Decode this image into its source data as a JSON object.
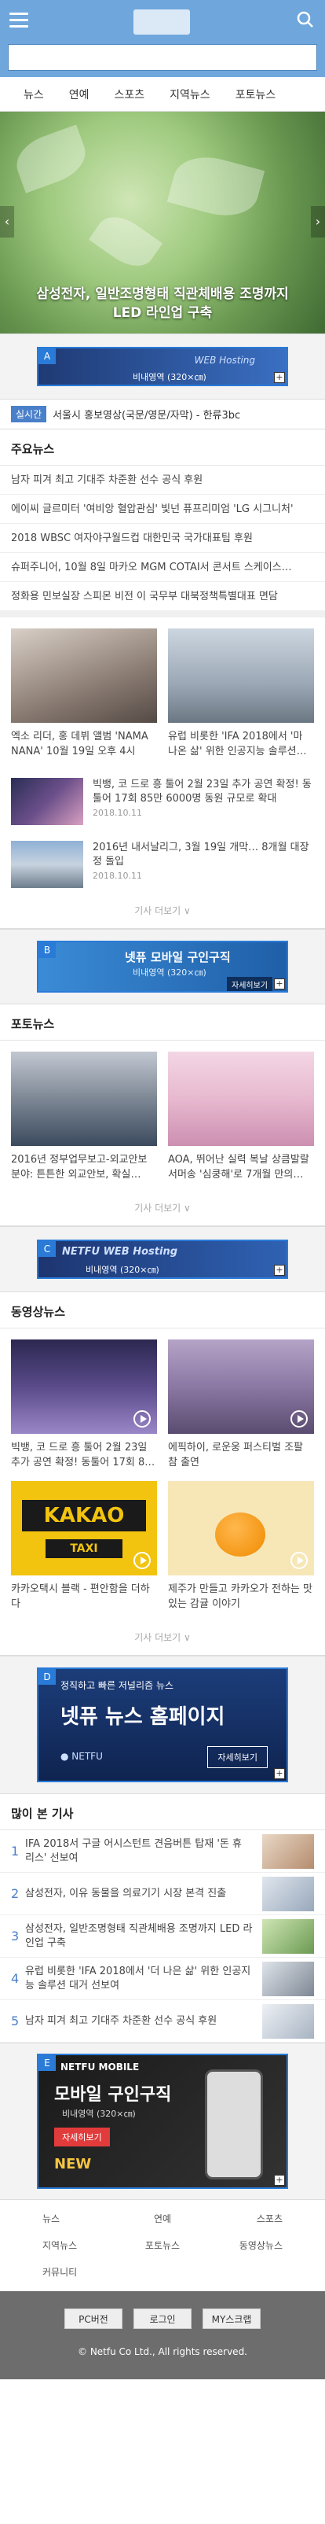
{
  "nav": [
    "뉴스",
    "연예",
    "스포츠",
    "지역뉴스",
    "포토뉴스"
  ],
  "hero": {
    "caption": "삼성전자, 일반조명형태 직관체배용 조명까지 LED 라인업 구축",
    "prev": "‹",
    "next": "›"
  },
  "ads": {
    "A": {
      "badge": "A",
      "title": "WEB Hosting",
      "sub": "비내영역 (320×㎝)"
    },
    "B": {
      "badge": "B",
      "title": "넷퓨 모바일 구인구직",
      "sub": "비내영역 (320×㎝)",
      "btn": "자세히보기"
    },
    "C": {
      "badge": "C",
      "title": "NETFU WEB Hosting",
      "sub": "비내영역 (320×㎝)"
    },
    "D": {
      "badge": "D",
      "tag": "정직하고 빠른 저널리즘 뉴스",
      "title": "넷퓨 뉴스 홈페이지",
      "btn": "자세히보기",
      "brand": "● NETFU"
    },
    "E": {
      "badge": "E",
      "brand": "NETFU MOBILE",
      "title": "모바일 구인구직",
      "sub": "비내영역 (320×㎝)",
      "btn": "자세히보기",
      "new": "NEW"
    },
    "plus": "+"
  },
  "breaking": {
    "tag": "실시간",
    "text": "서울시 홍보영상(국문/영문/자막) - 한류3bc"
  },
  "main_news": {
    "title": "주요뉴스",
    "items": [
      "남자 피겨 최고 기대주 차준환 선수 공식 후원",
      "에이씨 글르미터 '여비앙 혈압관심' 빛넌 퓨프리미엄 'LG 시그니처'",
      "2018 WBSC 여자야구월드컵 대한민국 국가대표팀 후원",
      "슈퍼주니어, 10월 8일 마카오 MGM COTAI서 콘서트 스케이스…",
      "정화용 민보실장 스피몬 비전 이 국무부 대북정책특별대표 면담"
    ]
  },
  "photo_cards": [
    {
      "caption": "엑소 리더, 홍 데뷔 앨범 'NAMA NANA' 10월 19일 오후 4시 공…"
    },
    {
      "caption": "유럽 비롯한 'IFA 2018에서 '마 나온 삶' 위한 인공지능 솔루션…"
    }
  ],
  "row_news": [
    {
      "title": "빅뱅, 코 드로 흥 툴어 2월 23일 추가 공연 확정! 동툴어 17회 85만 6000명 동원 규모로 확대",
      "date": "2018.10.11"
    },
    {
      "title": "2016년 내서날리그, 3월 19일 개막… 8개월 대장정 돌입",
      "date": "2018.10.11"
    }
  ],
  "more_label": "기사 더보기 ∨",
  "photo_news": {
    "title": "포토뉴스",
    "items": [
      {
        "caption": "2016년 정부업무보고-외교안보 분야: 튼튼한 외교안보, 확실…"
      },
      {
        "caption": "AOA, 뛰어난 실력 복날 상큼발랄 서머송 '심쿵해'로 7개월 만의…"
      }
    ]
  },
  "video_news": {
    "title": "동영상뉴스",
    "items": [
      {
        "caption": "빅뱅, 코 드로 흥 툴어 2월 23일 추가 공연 확정! 동툴어 17회 8…"
      },
      {
        "caption": "에픽하이, 로운웅 퍼스티벌 조팔 참 출연"
      },
      {
        "caption": "카카오택시 블랙 - 편안함을 더하다",
        "sign1": "KAKAO",
        "sign2": "TAXI"
      },
      {
        "caption": "제주가 만들고 카카오가 전하는 맛있는 감귤 이야기"
      }
    ]
  },
  "popular": {
    "title": "많이 본 기사",
    "items": [
      {
        "num": "1",
        "title": "IFA 2018서 구글 어시스턴트 견음버튼 탑재 '돈 휴 리스' 선보여"
      },
      {
        "num": "2",
        "title": "삼성전자, 이유 동물을 의료기기 시장 본격 진출"
      },
      {
        "num": "3",
        "title": "삼성전자, 일반조명형태 직관체배용 조명까지 LED 라인업 구축"
      },
      {
        "num": "4",
        "title": "유럽 비롯한 'IFA 2018에서 '더 나은 삶' 위한 인공지능 솔루션 대거 선보여"
      },
      {
        "num": "5",
        "title": "남자 피겨 최고 기대주 차준환 선수 공식 후원"
      }
    ]
  },
  "footer_nav": [
    "뉴스",
    "연예",
    "스포츠",
    "지역뉴스",
    "포토뉴스",
    "동영상뉴스",
    "커뮤니티"
  ],
  "footer": {
    "btns": [
      "PC버전",
      "로그인",
      "MY스크랩"
    ],
    "copy": "© Netfu Co Ltd., All rights reserved."
  },
  "colors": {
    "header": "#6fa7dd",
    "accent": "#4a7fc9",
    "ad_border": "#2a7bd8",
    "footer": "#6d6d6d"
  }
}
